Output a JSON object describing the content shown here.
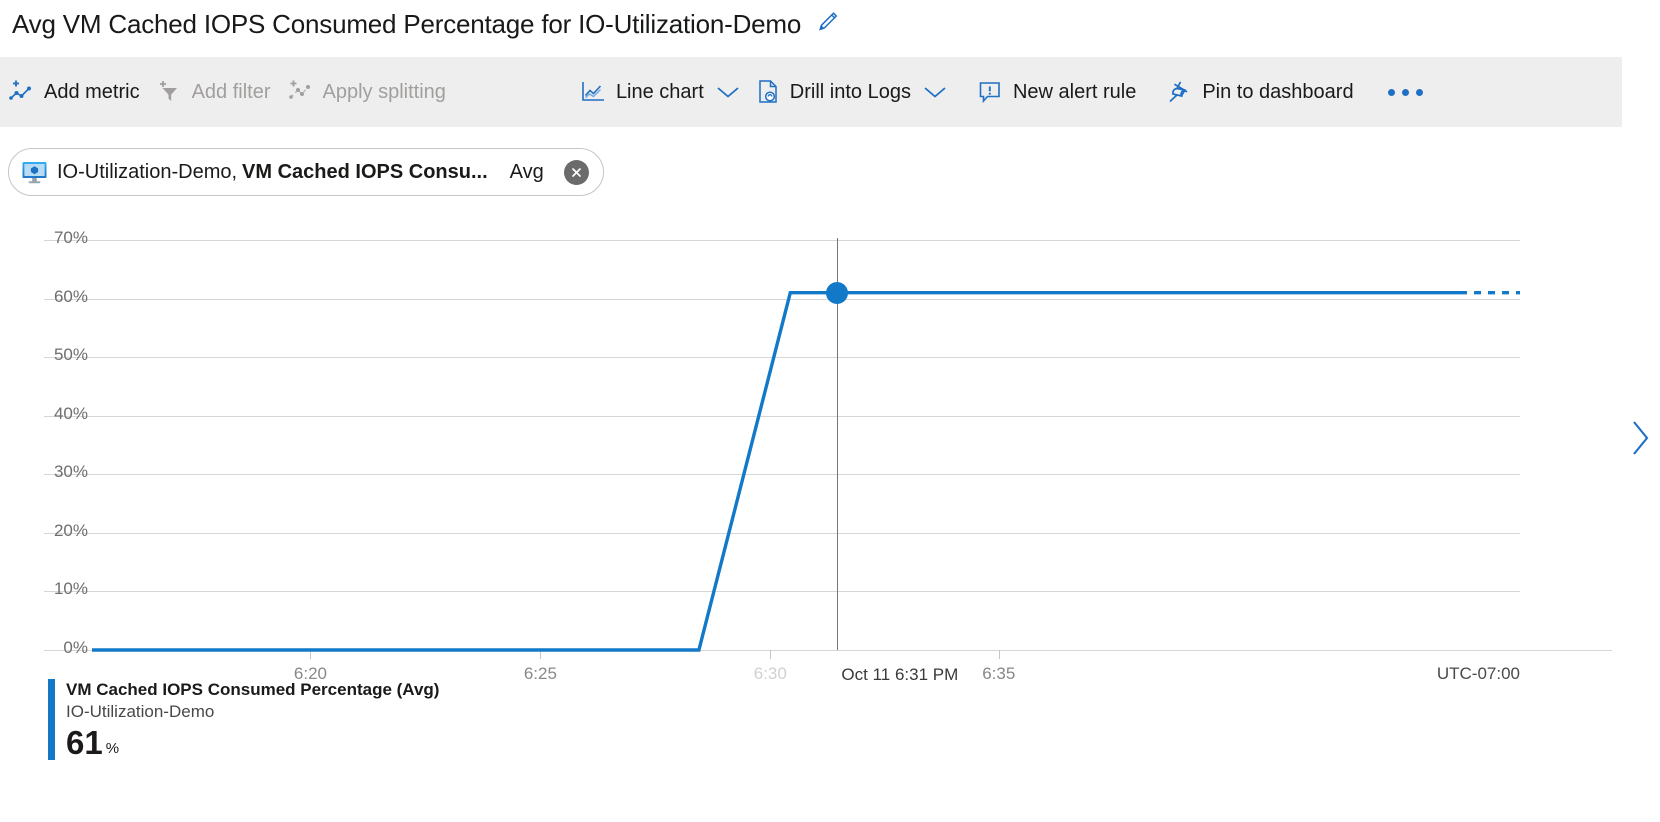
{
  "header": {
    "title": "Avg VM Cached IOPS Consumed Percentage for IO-Utilization-Demo",
    "edit_icon": "pencil-icon"
  },
  "toolbar": {
    "items": [
      {
        "label": "Add metric",
        "icon": "add-metric-icon",
        "enabled": true
      },
      {
        "label": "Add filter",
        "icon": "add-filter-icon",
        "enabled": false
      },
      {
        "label": "Apply splitting",
        "icon": "apply-splitting-icon",
        "enabled": false
      },
      {
        "label": "Line chart",
        "icon": "line-chart-icon",
        "enabled": true,
        "has_chevron": true
      },
      {
        "label": "Drill into Logs",
        "icon": "drill-into-logs-icon",
        "enabled": true,
        "has_chevron": true
      },
      {
        "label": "New alert rule",
        "icon": "new-alert-rule-icon",
        "enabled": true
      },
      {
        "label": "Pin to dashboard",
        "icon": "pin-icon",
        "enabled": true
      }
    ],
    "more_label": "More commands",
    "more_icon": "ellipsis-icon"
  },
  "metric_chip": {
    "resource_icon": "virtual-machine-icon",
    "resource": "IO-Utilization-Demo,",
    "metric": "VM Cached IOPS Consu...",
    "aggregation": "Avg",
    "close_icon": "close-circle-icon"
  },
  "legend": {
    "metric_label": "VM Cached IOPS Consumed Percentage (Avg)",
    "resource_label": "IO-Utilization-Demo",
    "value": "61",
    "unit": "%",
    "swatch_color": "#1278c8"
  },
  "colors": {
    "accent": "#1278c8",
    "toolbar_bg": "#eeeeee",
    "gridline": "#d6d6d6",
    "crosshair": "#767676",
    "disabled_text": "#a19f9d"
  },
  "expand_pane": {
    "icon": "chevron-right-icon",
    "label": "Expand"
  },
  "chart_data": {
    "type": "line",
    "title": "Avg VM Cached IOPS Consumed Percentage for IO-Utilization-Demo",
    "xlabel": "",
    "ylabel": "",
    "timezone_label": "UTC-07:00",
    "grid": true,
    "legend_position": "bottom-left",
    "ylim": [
      0,
      70
    ],
    "yticks": [
      0,
      10,
      20,
      30,
      40,
      50,
      60,
      70
    ],
    "ytick_labels": [
      "0%",
      "10%",
      "20%",
      "30%",
      "40%",
      "50%",
      "60%",
      "70%"
    ],
    "xticks": [
      "6:20",
      "6:25",
      "6:30",
      "6:35"
    ],
    "xtick_positions_pct": [
      15.3,
      31.4,
      47.5,
      63.5
    ],
    "xtick_faded": [
      false,
      false,
      true,
      false
    ],
    "xlim_labels": [
      "6:16",
      "6:41"
    ],
    "crosshair": {
      "label": "Oct 11 6:31 PM",
      "x_pct": 52.2,
      "value": 61,
      "marker": "circle"
    },
    "series": [
      {
        "name": "VM Cached IOPS Consumed Percentage (Avg)",
        "resource": "IO-Utilization-Demo",
        "color": "#1278c8",
        "unit": "%",
        "current_value": 61,
        "points_pct": [
          {
            "x": 0.0,
            "y": 0
          },
          {
            "x": 42.5,
            "y": 0
          },
          {
            "x": 48.9,
            "y": 61
          },
          {
            "x": 95.8,
            "y": 61
          },
          {
            "x": 100.0,
            "y": 61
          }
        ],
        "dashed_tail_from_x_pct": 95.8
      }
    ]
  }
}
